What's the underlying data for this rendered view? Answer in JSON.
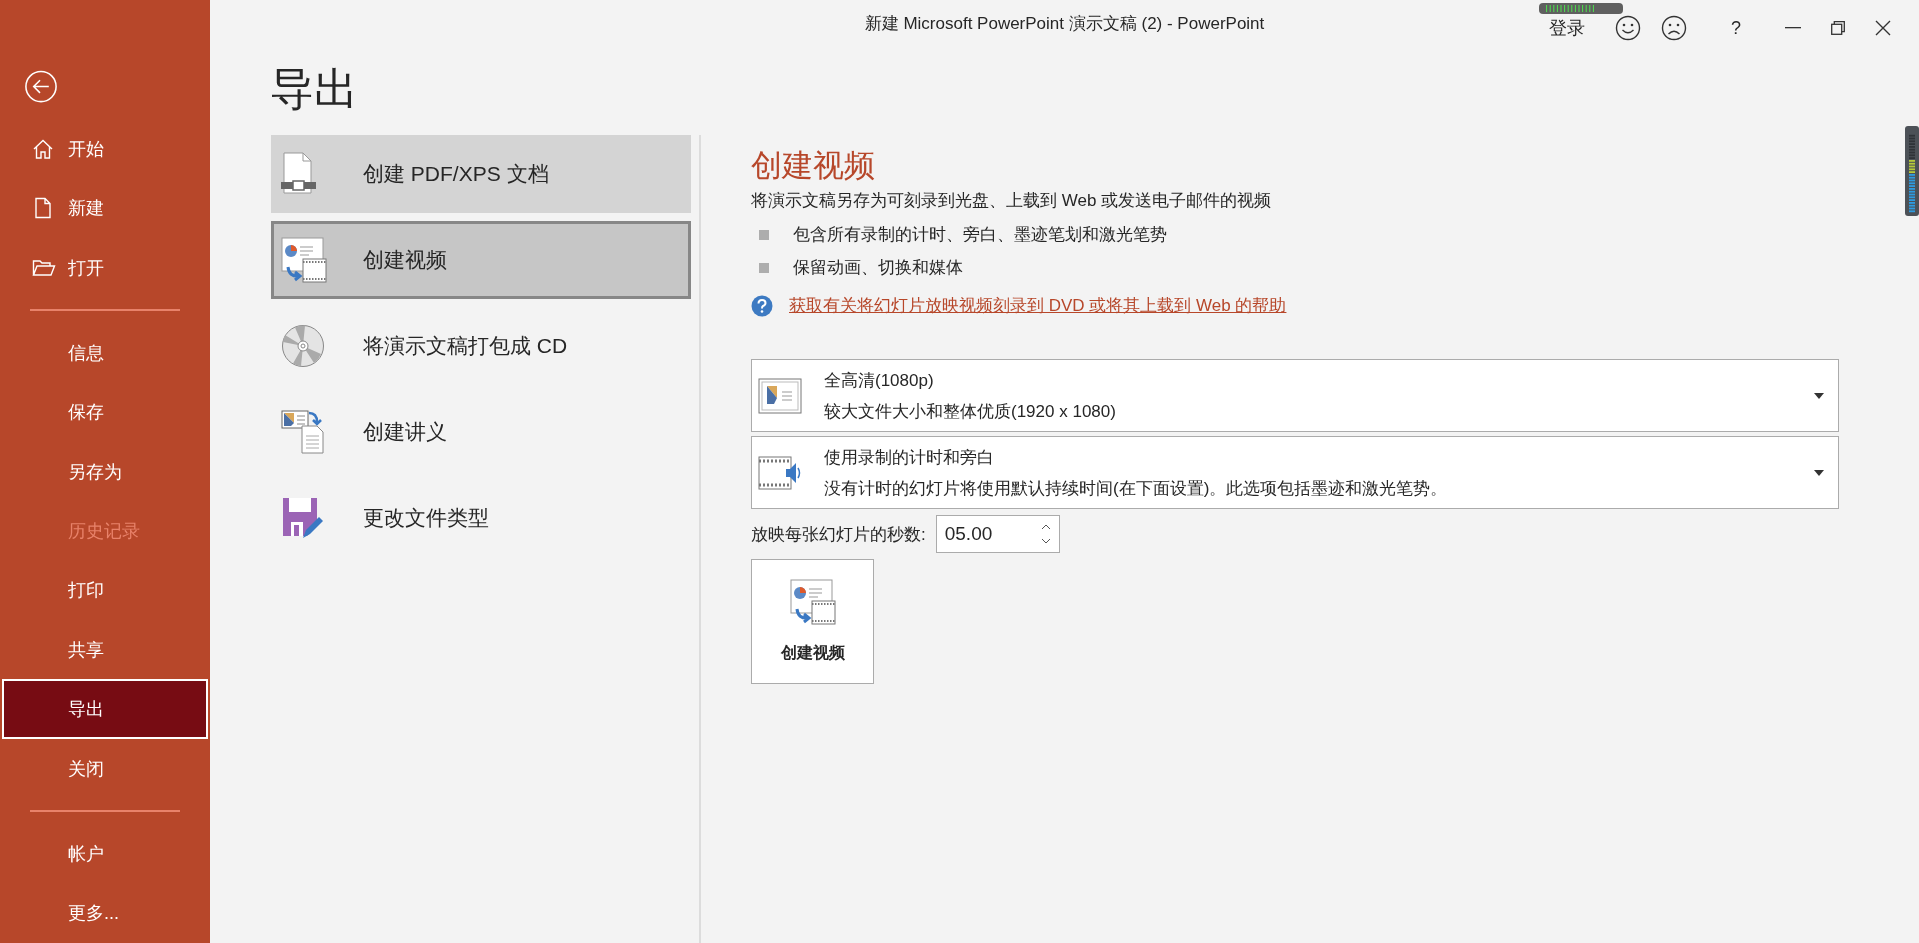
{
  "window": {
    "title": "新建 Microsoft PowerPoint 演示文稿 (2)  -  PowerPoint",
    "sign_in": "登录",
    "help": "?"
  },
  "sidebar": {
    "groups": [
      [
        {
          "label": "开始",
          "kind": "home",
          "selected": false,
          "disabled": false
        },
        {
          "label": "新建",
          "kind": "new",
          "selected": false,
          "disabled": false
        },
        {
          "label": "打开",
          "kind": "open",
          "selected": false,
          "disabled": false
        }
      ],
      [
        {
          "label": "信息",
          "kind": "text",
          "selected": false,
          "disabled": false
        },
        {
          "label": "保存",
          "kind": "text",
          "selected": false,
          "disabled": false
        },
        {
          "label": "另存为",
          "kind": "text",
          "selected": false,
          "disabled": false
        },
        {
          "label": "历史记录",
          "kind": "text",
          "selected": false,
          "disabled": true
        },
        {
          "label": "打印",
          "kind": "text",
          "selected": false,
          "disabled": false
        },
        {
          "label": "共享",
          "kind": "text",
          "selected": false,
          "disabled": false
        },
        {
          "label": "导出",
          "kind": "text",
          "selected": true,
          "disabled": false
        },
        {
          "label": "关闭",
          "kind": "text",
          "selected": false,
          "disabled": false
        }
      ],
      [
        {
          "label": "帐户",
          "kind": "text",
          "selected": false,
          "disabled": false
        },
        {
          "label": "更多...",
          "kind": "text",
          "selected": false,
          "disabled": false
        }
      ]
    ]
  },
  "page_title": "导出",
  "export_options": [
    {
      "label": "创建 PDF/XPS 文档",
      "kind": "pdf",
      "selected": false,
      "hovered": true
    },
    {
      "label": "创建视频",
      "kind": "video",
      "selected": true,
      "hovered": false
    },
    {
      "label": "将演示文稿打包成 CD",
      "kind": "cd",
      "selected": false,
      "hovered": false
    },
    {
      "label": "创建讲义",
      "kind": "handout",
      "selected": false,
      "hovered": false
    },
    {
      "label": "更改文件类型",
      "kind": "filetype",
      "selected": false,
      "hovered": false
    }
  ],
  "detail": {
    "heading": "创建视频",
    "description": "将演示文稿另存为可刻录到光盘、上载到 Web 或发送电子邮件的视频",
    "bullets": [
      "包含所有录制的计时、旁白、墨迹笔划和激光笔势",
      "保留动画、切换和媒体"
    ],
    "help_link": "获取有关将幻灯片放映视频刻录到 DVD 或将其上载到 Web 的帮助",
    "dropdowns": [
      {
        "kind": "quality",
        "title": "全高清(1080p)",
        "subtitle": "较大文件大小和整体优质(1920 x 1080)"
      },
      {
        "kind": "timing",
        "title": "使用录制的计时和旁白",
        "subtitle": "没有计时的幻灯片将使用默认持续时间(在下面设置)。此选项包括墨迹和激光笔势。"
      }
    ],
    "seconds": {
      "label": "放映每张幻灯片的秒数:",
      "value": "05.00"
    },
    "create_button": "创建视频"
  }
}
